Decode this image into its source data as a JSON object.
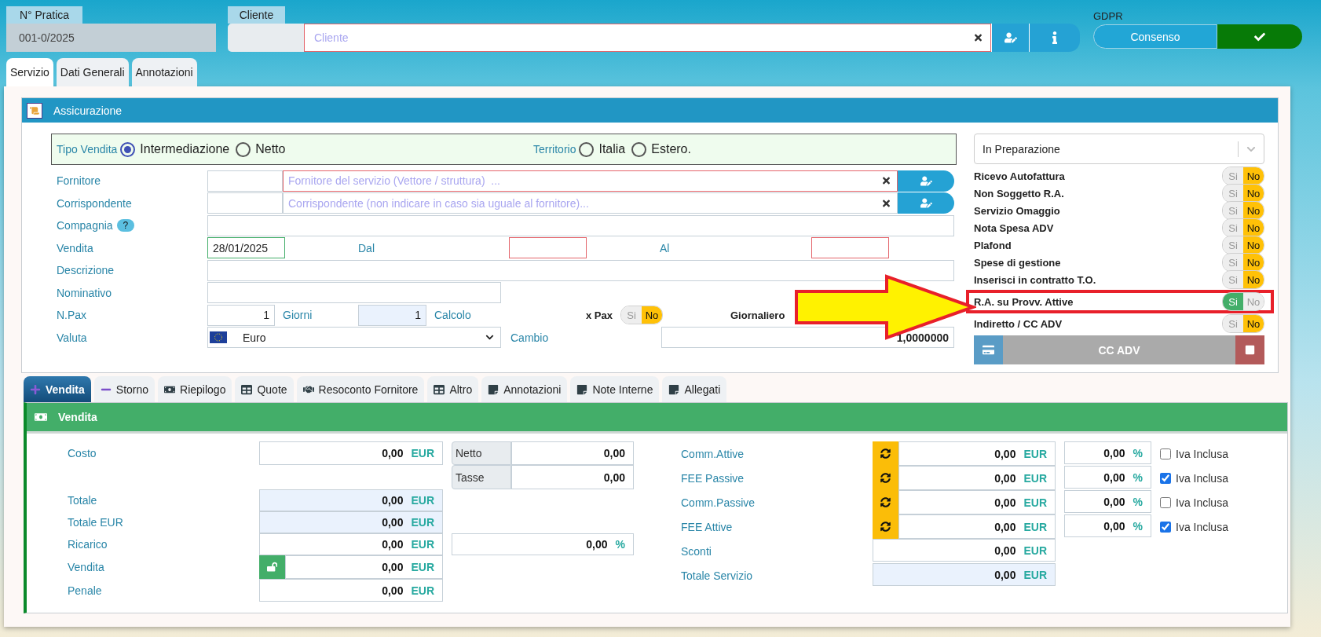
{
  "header": {
    "pratica": {
      "label": "N° Pratica",
      "value": "001-0/2025"
    },
    "cliente": {
      "label": "Cliente",
      "placeholder": "Cliente"
    },
    "gdpr": {
      "label": "GDPR",
      "button": "Consenso"
    }
  },
  "tabs": [
    {
      "label": "Servizio",
      "selected": true
    },
    {
      "label": "Dati Generali",
      "selected": false
    },
    {
      "label": "Annotazioni",
      "selected": false
    }
  ],
  "section": {
    "title": "Assicurazione",
    "tipo_vendita": {
      "label": "Tipo Vendita",
      "options": [
        {
          "label": "Intermediazione",
          "selected": true
        },
        {
          "label": "Netto",
          "selected": false
        }
      ]
    },
    "territorio": {
      "label": "Territorio",
      "options": [
        {
          "label": "Italia",
          "selected": false
        },
        {
          "label": "Estero.",
          "selected": false
        }
      ]
    },
    "fornitore": {
      "label": "Fornitore",
      "placeholder": "Fornitore del servizio (Vettore / struttura)  ..."
    },
    "corrispondente": {
      "label": "Corrispondente",
      "placeholder": "Corrispondente (non indicare in caso sia uguale al fornitore)..."
    },
    "compagnia": {
      "label": "Compagnia",
      "help": "?"
    },
    "vendita": {
      "label": "Vendita",
      "value": "28/01/2025"
    },
    "dal": {
      "label": "Dal"
    },
    "al": {
      "label": "Al"
    },
    "descrizione": {
      "label": "Descrizione"
    },
    "nominativo": {
      "label": "Nominativo"
    },
    "npax": {
      "label": "N.Pax",
      "value": "1"
    },
    "giorni": {
      "label": "Giorni",
      "value": "1"
    },
    "calcolo": {
      "label": "Calcolo"
    },
    "x_pax": {
      "label": "x Pax",
      "yes": "Si",
      "no": "No",
      "on": false
    },
    "giornaliero": {
      "label": "Giornaliero"
    },
    "valuta": {
      "label": "Valuta",
      "value": "Euro"
    },
    "cambio": {
      "label": "Cambio",
      "value": "1,0000000"
    },
    "status": "In Preparazione",
    "flags": [
      {
        "label": "Ricevo Autofattura",
        "yes": "Si",
        "no": "No",
        "on": false,
        "highlighted": false
      },
      {
        "label": "Non Soggetto R.A.",
        "yes": "Si",
        "no": "No",
        "on": false,
        "highlighted": false
      },
      {
        "label": "Servizio Omaggio",
        "yes": "Si",
        "no": "No",
        "on": false,
        "highlighted": false
      },
      {
        "label": "Nota Spesa ADV",
        "yes": "Si",
        "no": "No",
        "on": false,
        "highlighted": false
      },
      {
        "label": "Plafond",
        "yes": "Si",
        "no": "No",
        "on": false,
        "highlighted": false
      },
      {
        "label": "Spese di gestione",
        "yes": "Si",
        "no": "No",
        "on": false,
        "highlighted": false
      },
      {
        "label": "Inserisci in contratto T.O.",
        "yes": "Si",
        "no": "No",
        "on": false,
        "highlighted": false
      },
      {
        "label": "R.A. su Provv. Attive",
        "yes": "Si",
        "no": "No",
        "on": true,
        "highlighted": true
      },
      {
        "label": "Indiretto / CC ADV",
        "yes": "Si",
        "no": "No",
        "on": false,
        "highlighted": false
      }
    ],
    "cc_adv": "CC ADV"
  },
  "sub_tabs": [
    {
      "label": "Vendita",
      "kind": "plus",
      "selected": true
    },
    {
      "label": "Storno",
      "kind": "minus",
      "selected": false
    },
    {
      "label": "Riepilogo",
      "kind": "money",
      "selected": false
    },
    {
      "label": "Quote",
      "kind": "table",
      "selected": false
    },
    {
      "label": "Resoconto Fornitore",
      "kind": "handshake",
      "selected": false
    },
    {
      "label": "Altro",
      "kind": "table",
      "selected": false
    },
    {
      "label": "Annotazioni",
      "kind": "note",
      "selected": false
    },
    {
      "label": "Note Interne",
      "kind": "note",
      "selected": false
    },
    {
      "label": "Allegati",
      "kind": "note",
      "selected": false
    }
  ],
  "vendita_panel": {
    "title": "Vendita",
    "left_rows": [
      {
        "label": "Costo",
        "value": "0,00",
        "unit": "EUR",
        "kind": "plain"
      },
      {
        "label": "Totale",
        "value": "0,00",
        "unit": "EUR",
        "kind": "readonly"
      },
      {
        "label": "Totale EUR",
        "value": "0,00",
        "unit": "EUR",
        "kind": "readonly"
      },
      {
        "label": "Ricarico",
        "value": "0,00",
        "unit": "EUR",
        "kind": "plain"
      },
      {
        "label": "Vendita",
        "value": "0,00",
        "unit": "EUR",
        "kind": "lock"
      },
      {
        "label": "Penale",
        "value": "0,00",
        "unit": "EUR",
        "kind": "plain"
      }
    ],
    "netto": {
      "label": "Netto",
      "value": "0,00"
    },
    "tasse": {
      "label": "Tasse",
      "value": "0,00"
    },
    "ricarico_percent": {
      "value": "0,00",
      "unit": "%"
    },
    "right_rows": [
      {
        "label": "Comm.Attive",
        "value": "0,00",
        "unit": "EUR",
        "kind": "refresh",
        "percent": {
          "value": "0,00",
          "unit": "%"
        },
        "iva": {
          "label": "Iva Inclusa",
          "checked": false
        }
      },
      {
        "label": "FEE Passive",
        "value": "0,00",
        "unit": "EUR",
        "kind": "refresh",
        "percent": {
          "value": "0,00",
          "unit": "%"
        },
        "iva": {
          "label": "Iva Inclusa",
          "checked": true
        }
      },
      {
        "label": "Comm.Passive",
        "value": "0,00",
        "unit": "EUR",
        "kind": "refresh",
        "percent": {
          "value": "0,00",
          "unit": "%"
        },
        "iva": {
          "label": "Iva Inclusa",
          "checked": false
        }
      },
      {
        "label": "FEE Attive",
        "value": "0,00",
        "unit": "EUR",
        "kind": "refresh",
        "percent": {
          "value": "0,00",
          "unit": "%"
        },
        "iva": {
          "label": "Iva Inclusa",
          "checked": true
        }
      },
      {
        "label": "Sconti",
        "value": "0,00",
        "unit": "EUR",
        "kind": "plain"
      },
      {
        "label": "Totale Servizio",
        "value": "0,00",
        "unit": "EUR",
        "kind": "readonly"
      }
    ]
  }
}
